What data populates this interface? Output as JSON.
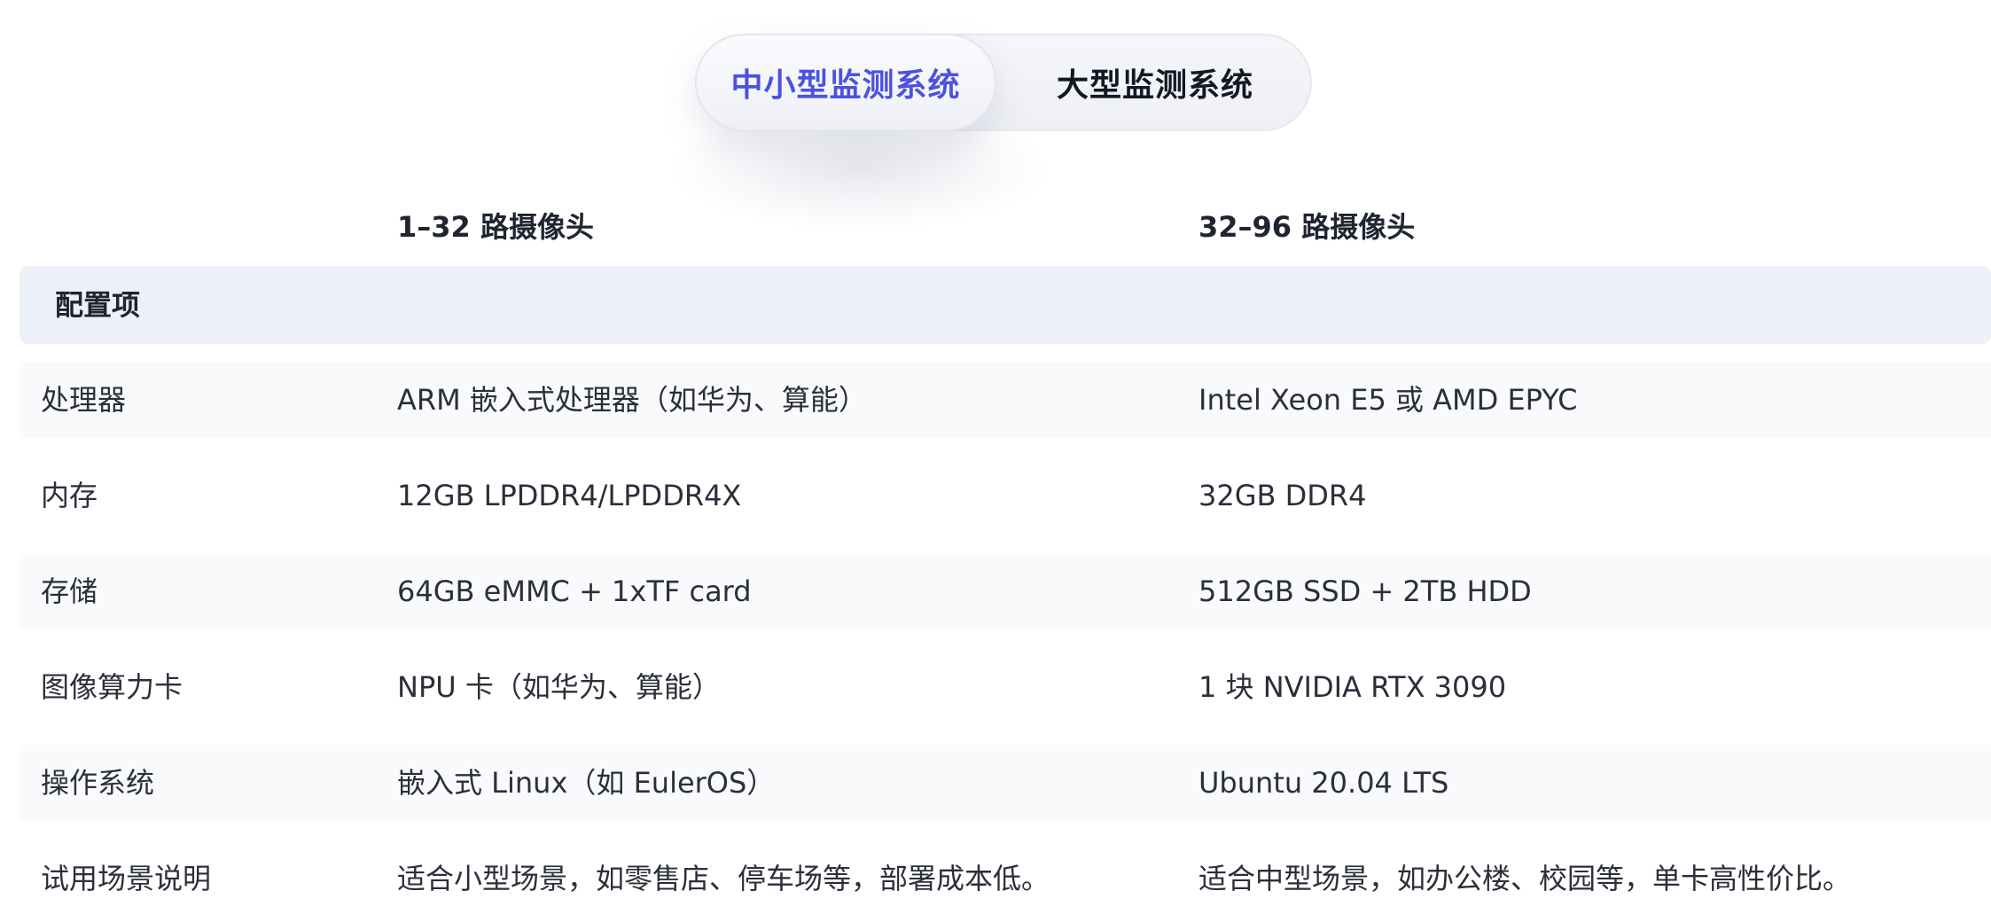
{
  "tabs": [
    {
      "label": "中小型监测系统",
      "active": true
    },
    {
      "label": "大型监测系统",
      "active": false
    }
  ],
  "columns": [
    "1–32 路摄像头",
    "32–96 路摄像头"
  ],
  "table": {
    "header_label": "配置项",
    "rows": [
      [
        "处理器",
        "ARM 嵌入式处理器（如华为、算能）",
        "Intel Xeon E5 或 AMD EPYC"
      ],
      [
        "内存",
        "12GB LPDDR4/LPDDR4X",
        "32GB DDR4"
      ],
      [
        "存储",
        "64GB eMMC + 1xTF card",
        "512GB SSD + 2TB HDD"
      ],
      [
        "图像算力卡",
        "NPU 卡（如华为、算能）",
        "1 块 NVIDIA RTX 3090"
      ],
      [
        "操作系统",
        "嵌入式 Linux（如 EulerOS）",
        "Ubuntu 20.04 LTS"
      ],
      [
        "试用场景说明",
        "适合小型场景，如零售店、停车场等，部署成本低。",
        "适合中型场景，如办公楼、校园等，单卡高性价比。"
      ]
    ]
  },
  "colors": {
    "accent": "#4b52e0",
    "header_bg": "#edf0f8",
    "stripe_bg": "#f9fafc"
  }
}
